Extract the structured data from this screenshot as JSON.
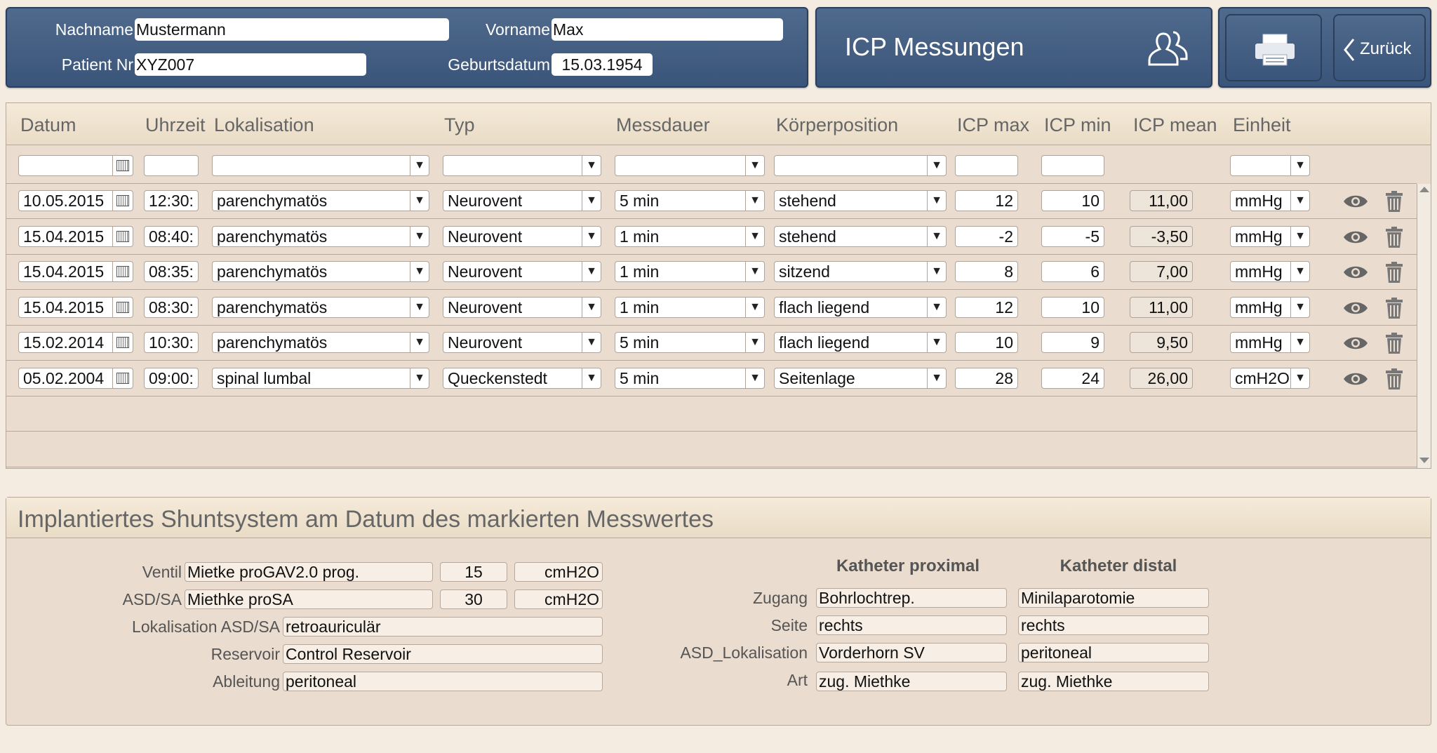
{
  "header": {
    "nachname_label": "Nachname",
    "nachname_value": "Mustermann",
    "vorname_label": "Vorname",
    "vorname_value": "Max",
    "patient_nr_label": "Patient Nr",
    "patient_nr_value": "XYZ007",
    "geburtsdatum_label": "Geburtsdatum",
    "geburtsdatum_value": "15.03.1954",
    "title": "ICP Messungen",
    "back_label": "Zurück"
  },
  "table": {
    "columns": [
      "Datum",
      "Uhrzeit",
      "Lokalisation",
      "Typ",
      "Messdauer",
      "Körperposition",
      "ICP max",
      "ICP min",
      "ICP mean",
      "Einheit"
    ],
    "rows": [
      {
        "datum": "10.05.2015",
        "uhrzeit": "12:30:",
        "lokalisation": "parenchymatös",
        "typ": "Neurovent",
        "messdauer": "5 min",
        "koerperposition": "stehend",
        "icp_max": "12",
        "icp_min": "10",
        "icp_mean": "11,00",
        "einheit": "mmHg"
      },
      {
        "datum": "15.04.2015",
        "uhrzeit": "08:40:",
        "lokalisation": "parenchymatös",
        "typ": "Neurovent",
        "messdauer": "1 min",
        "koerperposition": "stehend",
        "icp_max": "-2",
        "icp_min": "-5",
        "icp_mean": "-3,50",
        "einheit": "mmHg"
      },
      {
        "datum": "15.04.2015",
        "uhrzeit": "08:35:",
        "lokalisation": "parenchymatös",
        "typ": "Neurovent",
        "messdauer": "1 min",
        "koerperposition": "sitzend",
        "icp_max": "8",
        "icp_min": "6",
        "icp_mean": "7,00",
        "einheit": "mmHg"
      },
      {
        "datum": "15.04.2015",
        "uhrzeit": "08:30:",
        "lokalisation": "parenchymatös",
        "typ": "Neurovent",
        "messdauer": "1 min",
        "koerperposition": "flach liegend",
        "icp_max": "12",
        "icp_min": "10",
        "icp_mean": "11,00",
        "einheit": "mmHg"
      },
      {
        "datum": "15.02.2014",
        "uhrzeit": "10:30:",
        "lokalisation": "parenchymatös",
        "typ": "Neurovent",
        "messdauer": "5 min",
        "koerperposition": "flach liegend",
        "icp_max": "10",
        "icp_min": "9",
        "icp_mean": "9,50",
        "einheit": "mmHg"
      },
      {
        "datum": "05.02.2004",
        "uhrzeit": "09:00:",
        "lokalisation": "spinal lumbal",
        "typ": "Queckenstedt",
        "messdauer": "5 min",
        "koerperposition": "Seitenlage",
        "icp_max": "28",
        "icp_min": "24",
        "icp_mean": "26,00",
        "einheit": "cmH2O"
      }
    ]
  },
  "shunt": {
    "title": "Implantiertes Shuntsystem am Datum des markierten Messwertes",
    "ventil_label": "Ventil",
    "ventil_value": "Mietke proGAV2.0 prog.",
    "ventil_pressure": "15",
    "ventil_unit": "cmH2O",
    "asd_label": "ASD/SA",
    "asd_value": "Miethke proSA",
    "asd_pressure": "30",
    "asd_unit": "cmH2O",
    "lok_label": "Lokalisation ASD/SA",
    "lok_value": "retroauriculär",
    "reservoir_label": "Reservoir",
    "reservoir_value": "Control Reservoir",
    "ableitung_label": "Ableitung",
    "ableitung_value": "peritoneal",
    "proximal_header": "Katheter proximal",
    "distal_header": "Katheter distal",
    "zugang_label": "Zugang",
    "zugang_proximal": "Bohrlochtrep.",
    "zugang_distal": "Minilaparotomie",
    "seite_label": "Seite",
    "seite_proximal": "rechts",
    "seite_distal": "rechts",
    "asd_lok_label": "ASD_Lokalisation",
    "asd_lok_proximal": "Vorderhorn SV",
    "asd_lok_distal": "peritoneal",
    "art_label": "Art",
    "art_proximal": "zug. Miethke",
    "art_distal": "zug. Miethke"
  },
  "colors": {
    "header_blue": "#3f5a7e",
    "background": "#f4ece1",
    "table_bg": "#eadcce"
  },
  "icons": [
    "calendar-icon",
    "dropdown-arrow-icon",
    "eye-icon",
    "trash-icon",
    "people-icon",
    "printer-icon",
    "chevron-left-icon"
  ]
}
